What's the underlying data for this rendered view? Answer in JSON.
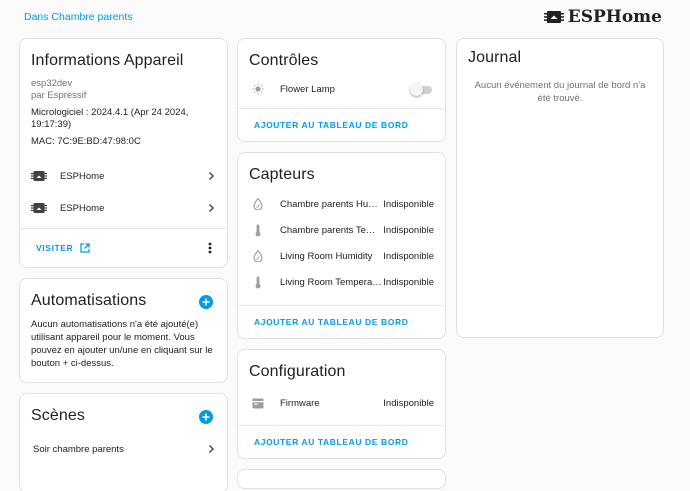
{
  "header": {
    "breadcrumb": "Dans Chambre parents",
    "brand": "ESPHome"
  },
  "device_info": {
    "title": "Informations Appareil",
    "model": "esp32dev",
    "manufacturer": "par Espressif",
    "firmware": "Micrologiciel : 2024.4.1 (Apr 24 2024, 19:17:39)",
    "mac": "MAC: 7C:9E:BD:47:98:0C",
    "links": [
      {
        "label": "ESPHome",
        "icon": "esphome-chip-icon"
      },
      {
        "label": "ESPHome",
        "icon": "esphome-chip-icon"
      }
    ],
    "visit_label": "VISITER",
    "visit_icon": "open-in-new-icon",
    "menu_icon": "more-vertical-icon"
  },
  "automations": {
    "title": "Automatisations",
    "empty_text": "Aucun automatisations n'a été ajouté(e) utilisant appareil pour le moment. Vous pouvez en ajouter un/une en cliquant sur le bouton + ci-dessus.",
    "add_icon": "plus-icon"
  },
  "scenes": {
    "title": "Scènes",
    "items": [
      "Soir chambre parents"
    ]
  },
  "controls": {
    "title": "Contrôles",
    "entities": [
      {
        "name": "Flower Lamp",
        "icon": "light-bulb-icon",
        "state": "off"
      }
    ],
    "action": "AJOUTER AU TABLEAU DE BORD"
  },
  "sensors": {
    "title": "Capteurs",
    "entities": [
      {
        "name": "Chambre parents Humidity",
        "state": "Indisponible",
        "icon": "water-percent-icon"
      },
      {
        "name": "Chambre parents Temperature",
        "state": "Indisponible",
        "icon": "thermometer-icon"
      },
      {
        "name": "Living Room Humidity",
        "state": "Indisponible",
        "icon": "water-percent-icon"
      },
      {
        "name": "Living Room Temperature",
        "state": "Indisponible",
        "icon": "thermometer-icon"
      }
    ],
    "action": "AJOUTER AU TABLEAU DE BORD"
  },
  "configuration": {
    "title": "Configuration",
    "entities": [
      {
        "name": "Firmware",
        "state": "Indisponible",
        "icon": "package-icon"
      }
    ],
    "action": "AJOUTER AU TABLEAU DE BORD"
  },
  "logbook": {
    "title": "Journal",
    "empty_text": "Aucun événement du journal de bord n'a été trouvé."
  },
  "colors": {
    "accent": "#039be5",
    "text": "#212121",
    "muted": "#727272",
    "background": "#fafafa"
  }
}
